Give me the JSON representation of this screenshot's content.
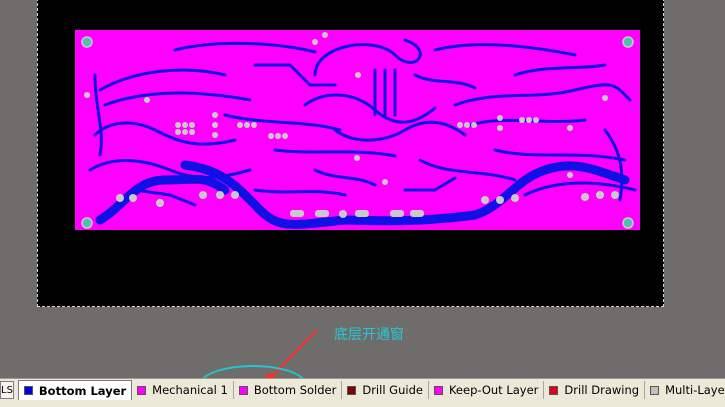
{
  "annotation": {
    "text": "底层开通窗"
  },
  "layer_tabs": {
    "scroll_stub": "LS",
    "items": [
      {
        "label": "Bottom Layer",
        "color": "#0000e0",
        "active": true
      },
      {
        "label": "Mechanical 1",
        "color": "#ff00ff",
        "active": false
      },
      {
        "label": "Bottom Solder",
        "color": "#ff00ff",
        "active": false
      },
      {
        "label": "Drill Guide",
        "color": "#800000",
        "active": false
      },
      {
        "label": "Keep-Out Layer",
        "color": "#ff00ff",
        "active": false
      },
      {
        "label": "Drill Drawing",
        "color": "#e0001a",
        "active": false
      },
      {
        "label": "Multi-Layer",
        "color": "#c0c0c0",
        "active": false
      }
    ]
  },
  "colors": {
    "pcb_solder_mask": "#ff00ff",
    "pcb_trace": "#1010e6",
    "pad": "#c9c9c9",
    "mount_hole": "#4fc0b0"
  }
}
